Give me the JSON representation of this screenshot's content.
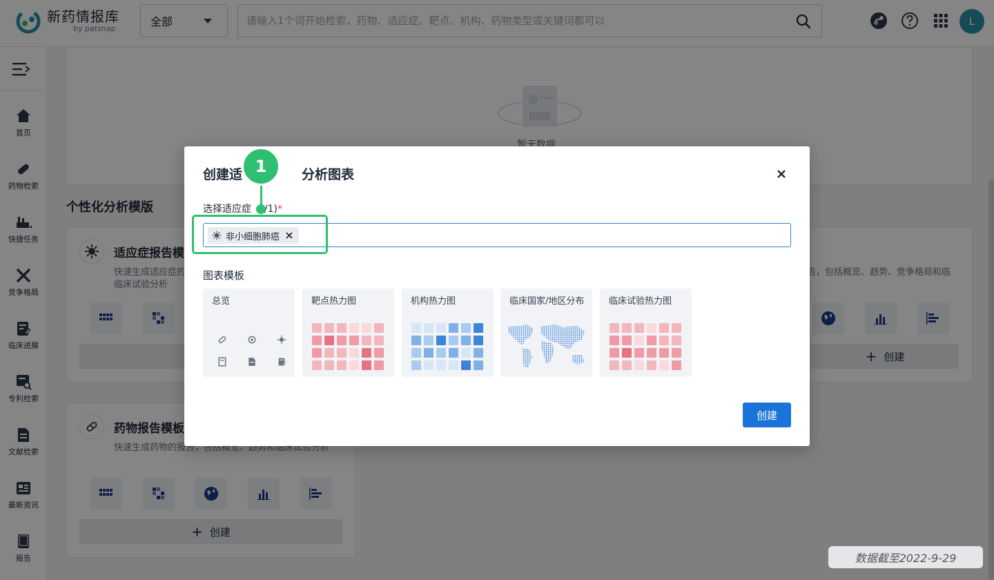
{
  "header": {
    "logo_title": "新药情报库",
    "logo_sub": "by patsnap",
    "scope_value": "全部",
    "search_placeholder": "请输入1个词开始检索，药物、适应症、靶点、机构、药物类型或关键词都可以",
    "avatar_letter": "L"
  },
  "sidebar": {
    "items": [
      {
        "label": "首页",
        "icon": "home-icon"
      },
      {
        "label": "药物检索",
        "icon": "pill-icon"
      },
      {
        "label": "快捷任务",
        "icon": "task-icon"
      },
      {
        "label": "竞争格局",
        "icon": "compete-icon"
      },
      {
        "label": "临床进展",
        "icon": "clinical-icon"
      },
      {
        "label": "专利检索",
        "icon": "patent-icon"
      },
      {
        "label": "文献检索",
        "icon": "literature-icon"
      },
      {
        "label": "最新资讯",
        "icon": "news-icon"
      },
      {
        "label": "报告",
        "icon": "report-icon"
      }
    ]
  },
  "main": {
    "empty_text": "暂无数据",
    "section_title": "个性化分析模版",
    "indication_card": {
      "name": "适应症报告模",
      "desc_line1": "快速生成适应症的",
      "desc_line2": "临床试验分析",
      "desc_right": "告，包括概览、趋势、竞争格局和临",
      "create_label": "创建"
    },
    "drug_card": {
      "name": "药物报告模板",
      "desc": "快速生成药物的报告，包括概览、趋势和临床试验分析",
      "create_label": "创建"
    }
  },
  "modal": {
    "title_left": "创建适",
    "title_right": "分析图表",
    "field_label_left": "选择适应症",
    "field_label_right": "1/1)",
    "required_mark": "*",
    "chip_label": "非小细胞肺癌",
    "section_label": "图表模板",
    "templates": [
      {
        "title": "总览"
      },
      {
        "title": "靶点热力图"
      },
      {
        "title": "机构热力图"
      },
      {
        "title": "临床国家/地区分布"
      },
      {
        "title": "临床试验热力图"
      }
    ],
    "create_label": "创建"
  },
  "callout": {
    "number": "1"
  },
  "footer": {
    "data_date": "数据截至2022-9-29"
  },
  "colors": {
    "primary": "#1a73d9",
    "callout": "#2fbf71",
    "heat_red": [
      "#f9d9dc",
      "#f4b6bd",
      "#ef9aa4",
      "#e8727f"
    ],
    "heat_blue": [
      "#d6e6f7",
      "#a9cbee",
      "#7fb1e6",
      "#3c86d8"
    ]
  }
}
